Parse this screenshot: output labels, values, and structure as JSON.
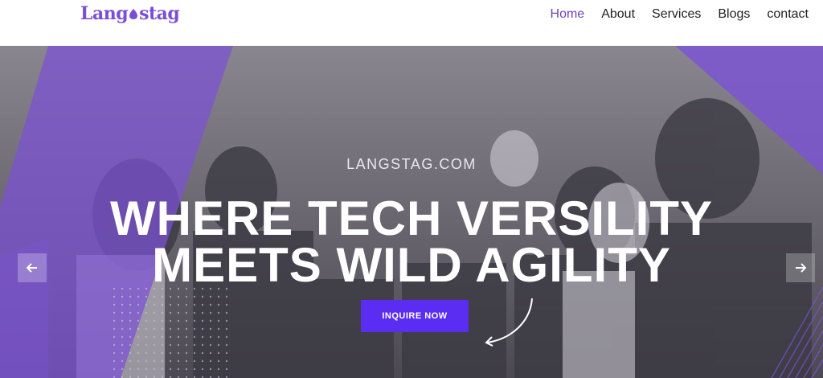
{
  "brand": {
    "logo_text_pre": "Lang",
    "logo_text_post": "stag",
    "color": "#7a4fd6"
  },
  "nav": {
    "items": [
      {
        "label": "Home",
        "active": true
      },
      {
        "label": "About",
        "active": false
      },
      {
        "label": "Services",
        "active": false
      },
      {
        "label": "Blogs",
        "active": false
      },
      {
        "label": "contact",
        "active": false
      }
    ]
  },
  "hero": {
    "subtitle": "LANGSTAG.COM",
    "headline_line1": "WHERE TECH VERSILITY",
    "headline_line2": "MEETS WILD AGILITY",
    "cta_label": "INQUIRE NOW",
    "cta_color": "#5b2df2",
    "prev_icon": "arrow-left-icon",
    "next_icon": "arrow-right-icon"
  }
}
